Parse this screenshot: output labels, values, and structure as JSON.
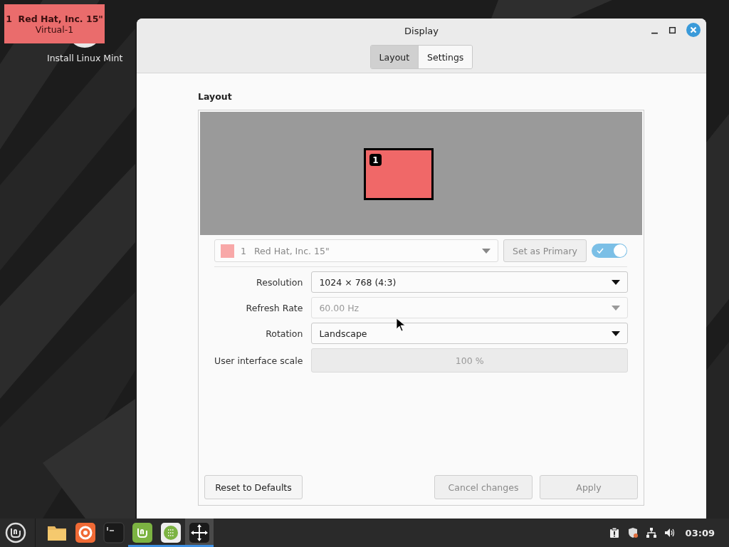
{
  "overlay": {
    "number": "1",
    "name": "Red Hat, Inc. 15\"",
    "output": "Virtual-1"
  },
  "desktop_icons": [
    {
      "label": "Install Linux Mint"
    }
  ],
  "window": {
    "title": "Display"
  },
  "tabs": [
    {
      "label": "Layout",
      "selected": true
    },
    {
      "label": "Settings",
      "selected": false
    }
  ],
  "section_title": "Layout",
  "monitors": [
    {
      "number": "1",
      "color": "#f06868"
    }
  ],
  "monitor_select": {
    "color": "#f8a8a8",
    "number": "1",
    "name": "Red Hat, Inc. 15\""
  },
  "set_primary": {
    "label": "Set as Primary",
    "disabled": true
  },
  "monitor_enabled": {
    "on": true
  },
  "settings": [
    {
      "label": "Resolution",
      "kind": "dropdown",
      "value": "1024 × 768 (4:3)",
      "disabled": false
    },
    {
      "label": "Refresh Rate",
      "kind": "dropdown",
      "value": "60.00 Hz",
      "disabled": true
    },
    {
      "label": "Rotation",
      "kind": "dropdown",
      "value": "Landscape",
      "disabled": false
    },
    {
      "label": "User interface scale",
      "kind": "scale",
      "value": "100 %",
      "disabled": true
    }
  ],
  "buttons": [
    {
      "label": "Reset to Defaults",
      "disabled": false
    },
    {
      "label": "Cancel changes",
      "disabled": true
    },
    {
      "label": "Apply",
      "disabled": true
    }
  ],
  "taskbar": {
    "apps": [
      {
        "kind": "folder",
        "running": false,
        "focused": false
      },
      {
        "kind": "browser",
        "running": false,
        "focused": false
      },
      {
        "kind": "terminal",
        "running": false,
        "focused": false
      },
      {
        "kind": "mint",
        "running": true,
        "focused": false
      },
      {
        "kind": "grid",
        "running": true,
        "focused": false
      },
      {
        "kind": "move",
        "running": true,
        "focused": true
      }
    ],
    "clock": "03:09"
  }
}
